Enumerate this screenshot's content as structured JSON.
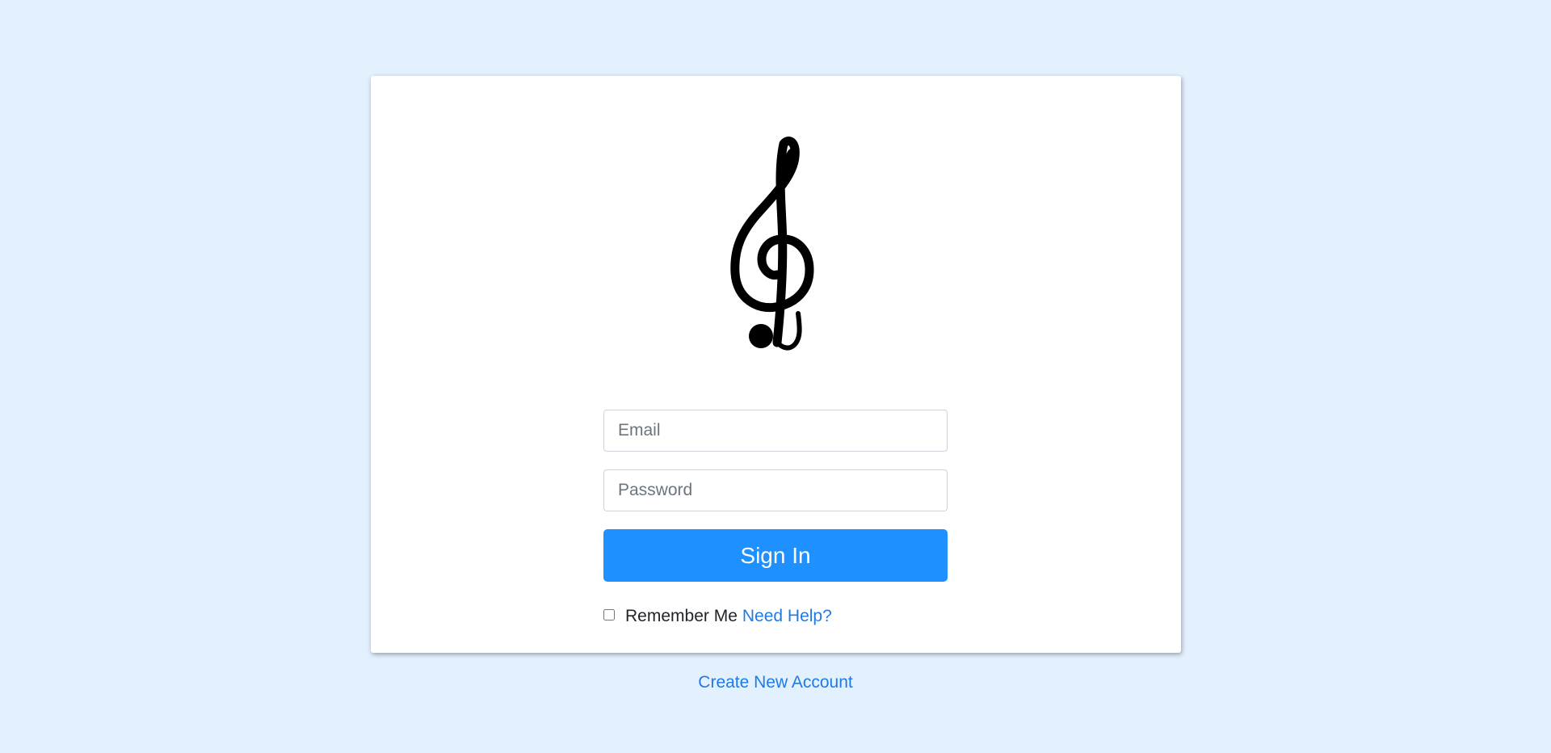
{
  "login": {
    "email_placeholder": "Email",
    "password_placeholder": "Password",
    "signin_label": "Sign In",
    "remember_label": "Remember Me",
    "help_label": "Need Help?",
    "create_account_label": "Create New Account",
    "logo_icon": "treble-clef-icon"
  },
  "colors": {
    "background": "#e3f0fe",
    "card": "#ffffff",
    "accent": "#1e90ff",
    "link": "#1e7be6"
  }
}
